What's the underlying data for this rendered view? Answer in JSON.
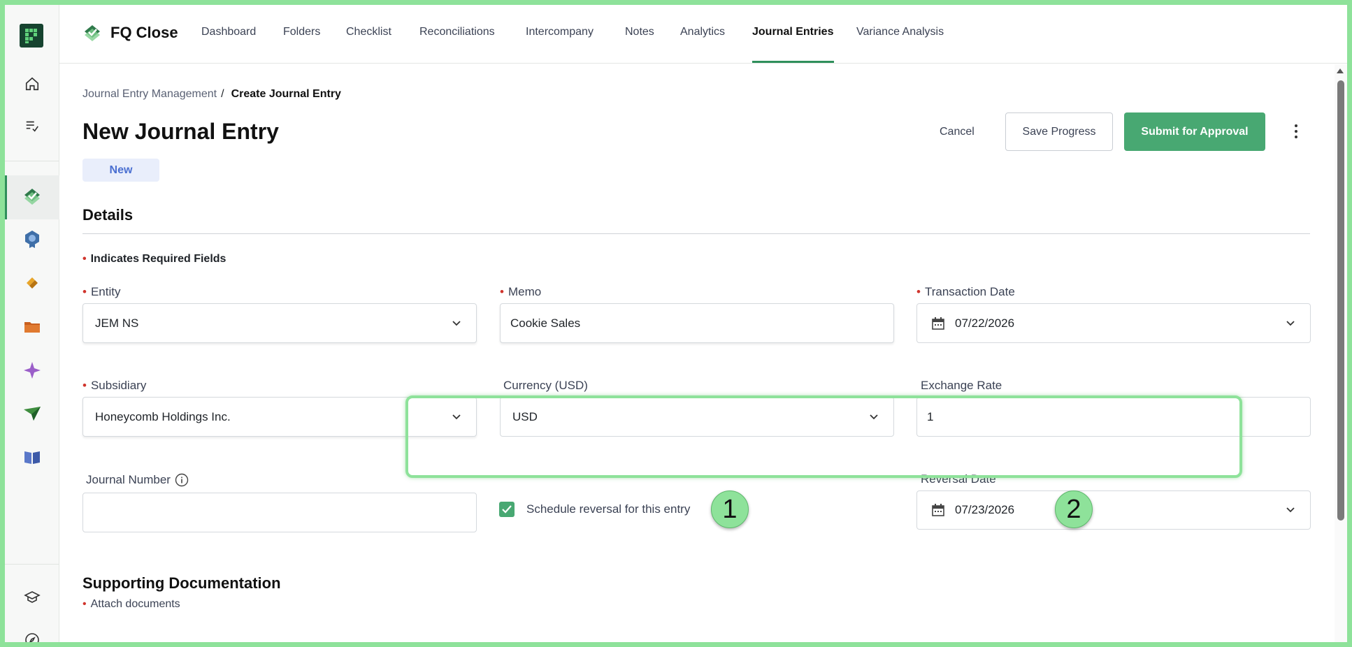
{
  "app": {
    "name": "FQ Close"
  },
  "nav": {
    "items": [
      {
        "label": "Dashboard"
      },
      {
        "label": "Folders"
      },
      {
        "label": "Checklist"
      },
      {
        "label": "Reconciliations"
      },
      {
        "label": "Intercompany"
      },
      {
        "label": "Notes"
      },
      {
        "label": "Analytics"
      },
      {
        "label": "Journal Entries",
        "active": true
      },
      {
        "label": "Variance Analysis"
      }
    ]
  },
  "breadcrumb": {
    "parent": "Journal Entry Management",
    "separator": "/",
    "current": "Create Journal Entry"
  },
  "page": {
    "title": "New Journal Entry",
    "status": "New"
  },
  "actions": {
    "cancel": "Cancel",
    "save": "Save Progress",
    "submit": "Submit for Approval"
  },
  "details": {
    "title": "Details",
    "required_note": "Indicates Required Fields",
    "required_marker": "•",
    "entity": {
      "label": "Entity",
      "value": "JEM NS"
    },
    "memo": {
      "label": "Memo",
      "value": "Cookie Sales"
    },
    "transaction_date": {
      "label": "Transaction Date",
      "value": "07/22/2026"
    },
    "subsidiary": {
      "label": "Subsidiary",
      "value": "Honeycomb Holdings Inc."
    },
    "currency": {
      "label": "Currency (USD)",
      "value": "USD"
    },
    "exchange_rate": {
      "label": "Exchange Rate",
      "value": "1"
    },
    "journal_number": {
      "label": "Journal Number",
      "value": ""
    },
    "schedule_reversal": {
      "label": "Schedule reversal for this entry",
      "checked": true
    },
    "reversal_date": {
      "label": "Reversal Date",
      "value": "07/23/2026"
    }
  },
  "markers": {
    "one": "1",
    "two": "2"
  },
  "supporting": {
    "title": "Supporting Documentation",
    "attach": "Attach documents"
  },
  "colors": {
    "accent": "#48a872",
    "highlight": "#8ee29a",
    "required": "#d0342c",
    "badge_bg": "#e9eefb"
  }
}
